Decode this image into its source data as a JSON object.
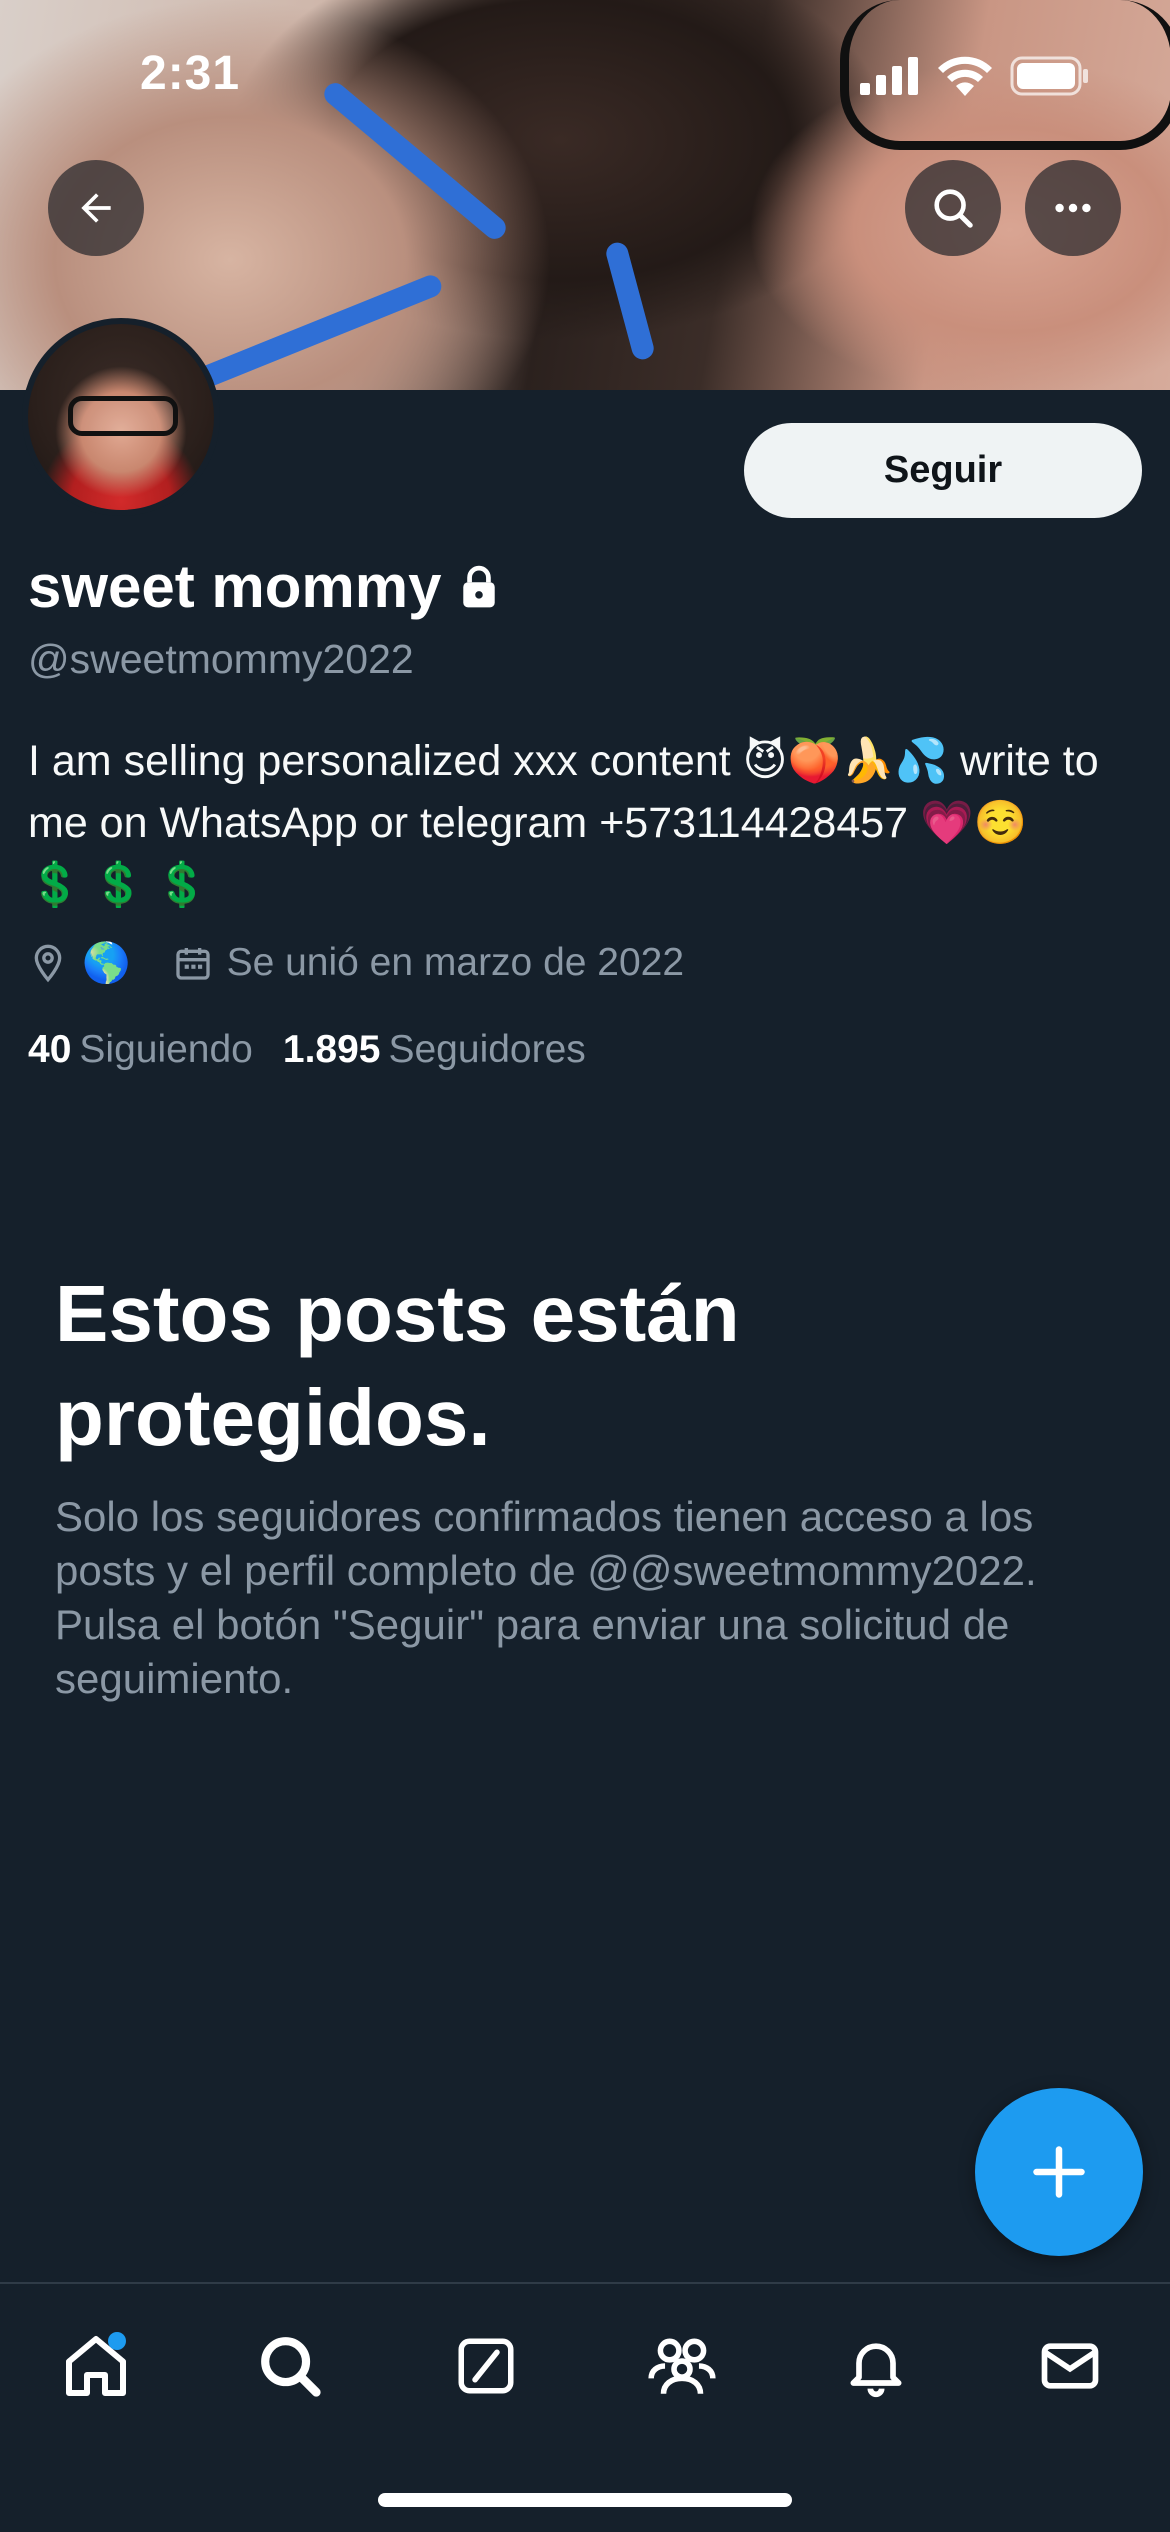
{
  "status_bar": {
    "time": "2:31"
  },
  "header": {
    "back_icon": "arrow-left-icon",
    "search_icon": "search-icon",
    "more_icon": "more-horizontal-icon"
  },
  "profile": {
    "follow_label": "Seguir",
    "display_name": "sweet mommy",
    "lock_icon": "lock-icon",
    "handle": "@sweetmommy2022",
    "bio_text": "I am selling personalized xxx content 😈🍑🍌💦 write to me on WhatsApp or telegram +573114428457 💗☺️",
    "bio_dollars": "💲💲💲",
    "location": "🌎",
    "joined": "Se unió en marzo de 2022",
    "following_count": "40",
    "following_label": "Siguiendo",
    "followers_count": "1.895",
    "followers_label": "Seguidores"
  },
  "protected": {
    "title": "Estos posts están protegidos.",
    "body": "Solo los seguidores confirmados tienen acceso a los posts y el perfil completo de @@sweetmommy2022. Pulsa el botón \"Seguir\" para enviar una solicitud de seguimiento."
  },
  "fab": {
    "icon": "plus-icon"
  },
  "bottom_nav": {
    "items": [
      "home-icon",
      "search-icon",
      "grok-icon",
      "communities-icon",
      "notifications-icon",
      "messages-icon"
    ]
  },
  "colors": {
    "background": "#15202b",
    "accent": "#1d9bf0",
    "secondary_text": "#8b98a5"
  }
}
